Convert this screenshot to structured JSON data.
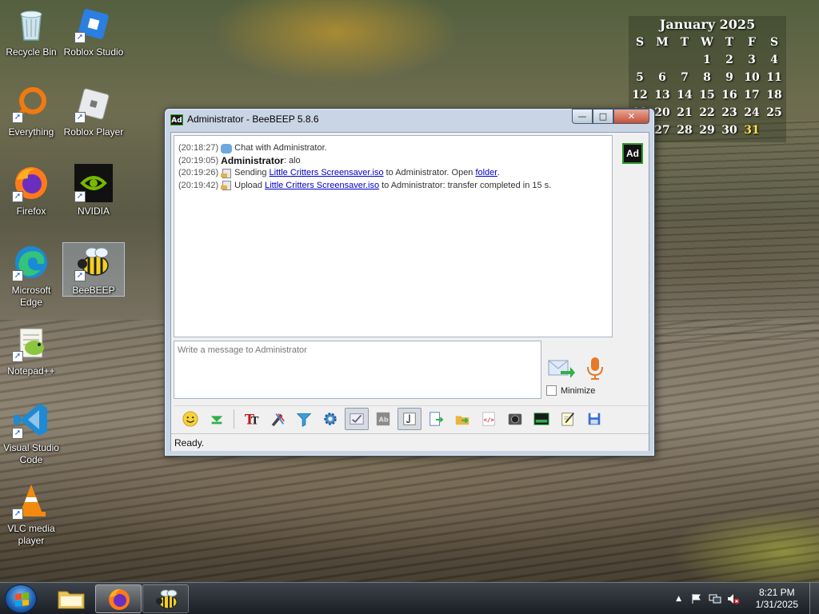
{
  "desktop": {
    "icons": [
      {
        "label": "Recycle Bin"
      },
      {
        "label": "Roblox Studio"
      },
      {
        "label": "Everything"
      },
      {
        "label": "Roblox Player"
      },
      {
        "label": "Firefox"
      },
      {
        "label": "NVIDIA"
      },
      {
        "label": "Microsoft Edge"
      },
      {
        "label": "BeeBEEP"
      },
      {
        "label": "Notepad++"
      },
      {
        "label": "Visual Studio Code"
      },
      {
        "label": "VLC media player"
      }
    ]
  },
  "calendar": {
    "title": "January 2025",
    "weekdays": [
      "S",
      "M",
      "T",
      "W",
      "T",
      "F",
      "S"
    ],
    "rows": [
      [
        "",
        "",
        "",
        "1",
        "2",
        "3",
        "4"
      ],
      [
        "5",
        "6",
        "7",
        "8",
        "9",
        "10",
        "11"
      ],
      [
        "12",
        "13",
        "14",
        "15",
        "16",
        "17",
        "18"
      ],
      [
        "19",
        "20",
        "21",
        "22",
        "23",
        "24",
        "25"
      ],
      [
        "26",
        "27",
        "28",
        "29",
        "30",
        "31",
        ""
      ]
    ],
    "today": "31"
  },
  "window": {
    "title": "Administrator - BeeBEEP 5.8.6",
    "app_icon": "Ad",
    "controls": {
      "minimize": "—",
      "maximize": "□",
      "close": "✕"
    },
    "chat": {
      "line1": {
        "time": "(20:18:27)",
        "text": "Chat with Administrator."
      },
      "line2": {
        "time": "(20:19:05)",
        "name": "Administrator",
        "text": ": alo"
      },
      "line3": {
        "time": "(20:19:26)",
        "pre": "Sending",
        "file": "Little Critters Screensaver.iso",
        "mid": "to Administrator. Open",
        "link": "folder",
        "post": "."
      },
      "line4": {
        "time": "(20:19:42)",
        "pre": "Upload",
        "file": "Little Critters Screensaver.iso",
        "post": "to Administrator: transfer completed in 15 s."
      }
    },
    "avatar": "Ad",
    "message_placeholder": "Write a message to Administrator",
    "minimize_label": "Minimize",
    "status": "Ready.",
    "toolbar_icons": [
      "smiley-icon",
      "green-arrow-down-icon",
      "font-icon",
      "color-pen-icon",
      "filter-icon",
      "settings-gear-icon",
      "spell-check-icon",
      "compact-icon",
      "text-toggle-icon",
      "export-icon",
      "send-file-icon",
      "html-icon",
      "camera-icon",
      "screenshot-icon",
      "notes-icon",
      "save-chat-icon"
    ]
  },
  "taskbar": {
    "items": [
      "file-explorer-icon",
      "firefox-icon",
      "beebeep-icon"
    ],
    "clock_time": "8:21 PM",
    "clock_date": "1/31/2025"
  },
  "colors": {
    "link": "#0000cc",
    "today": "#ffe14a",
    "avatar_border": "#2a9a2a"
  }
}
